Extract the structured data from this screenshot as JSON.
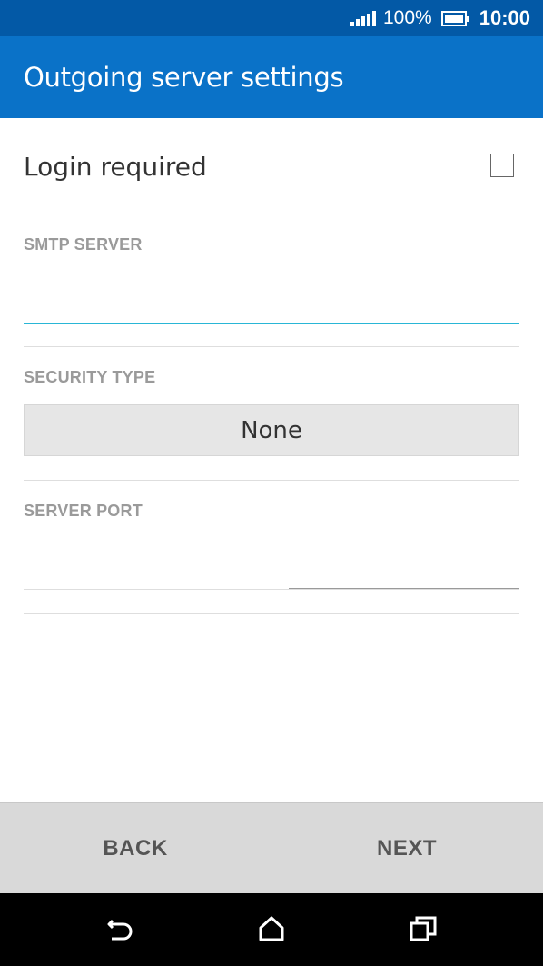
{
  "status_bar": {
    "battery_percent": "100%",
    "time": "10:00",
    "icons": [
      "signal-icon",
      "battery-icon"
    ]
  },
  "app_bar": {
    "title": "Outgoing server settings"
  },
  "login": {
    "label": "Login required",
    "checked": false
  },
  "smtp": {
    "label": "SMTP SERVER",
    "value": ""
  },
  "security": {
    "label": "SECURITY TYPE",
    "selected": "None"
  },
  "port": {
    "label": "SERVER PORT",
    "value": ""
  },
  "buttons": {
    "back": "BACK",
    "next": "NEXT"
  },
  "nav": {
    "icons": [
      "back-icon",
      "home-icon",
      "recents-icon"
    ]
  },
  "colors": {
    "status_bar": "#0359a6",
    "app_bar": "#0a72c8",
    "input_focus": "#29b6d6"
  }
}
